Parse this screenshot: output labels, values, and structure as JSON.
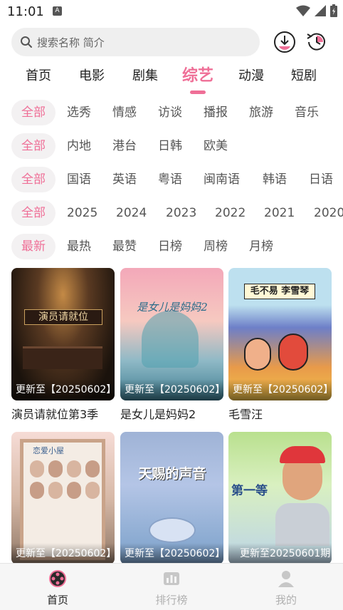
{
  "status_bar": {
    "time": "11:01",
    "badge": "A"
  },
  "search": {
    "placeholder": "搜索名称 简介"
  },
  "header_icons": [
    "history-icon",
    "download-icon"
  ],
  "main_tabs": [
    {
      "label": "首页"
    },
    {
      "label": "电影"
    },
    {
      "label": "剧集"
    },
    {
      "label": "综艺",
      "active": true
    },
    {
      "label": "动漫"
    },
    {
      "label": "短剧"
    }
  ],
  "filters": {
    "category": [
      "全部",
      "选秀",
      "情感",
      "访谈",
      "播报",
      "旅游",
      "音乐"
    ],
    "region": [
      "全部",
      "内地",
      "港台",
      "日韩",
      "欧美"
    ],
    "language": [
      "全部",
      "国语",
      "英语",
      "粤语",
      "闽南语",
      "韩语",
      "日语"
    ],
    "year": [
      "全部",
      "2025",
      "2024",
      "2023",
      "2022",
      "2021",
      "2020"
    ],
    "sort": [
      "最新",
      "最热",
      "最赞",
      "日榜",
      "周榜",
      "月榜"
    ]
  },
  "cards": [
    {
      "title": "演员请就位第3季",
      "status": "更新至【20250602】",
      "poster_text": "演员请就位"
    },
    {
      "title": "是女儿是妈妈2",
      "status": "更新至【20250602】",
      "poster_text": "是女儿是妈妈2"
    },
    {
      "title": "毛雪汪",
      "status": "更新至【20250602】",
      "poster_text": "毛不易 李雪琴"
    },
    {
      "title": "",
      "status": "更新至【20250602】",
      "poster_text": "恋爱小屋"
    },
    {
      "title": "",
      "status": "更新至【20250602】",
      "poster_text": "天赐的声音"
    },
    {
      "title": "",
      "status": "更新至20250601期",
      "poster_text": "第一等"
    }
  ],
  "bottom_nav": [
    {
      "label": "首页",
      "active": true
    },
    {
      "label": "排行榜"
    },
    {
      "label": "我的"
    }
  ],
  "colors": {
    "accent": "#ef6f97",
    "chip_bg": "#f3f1f2"
  }
}
